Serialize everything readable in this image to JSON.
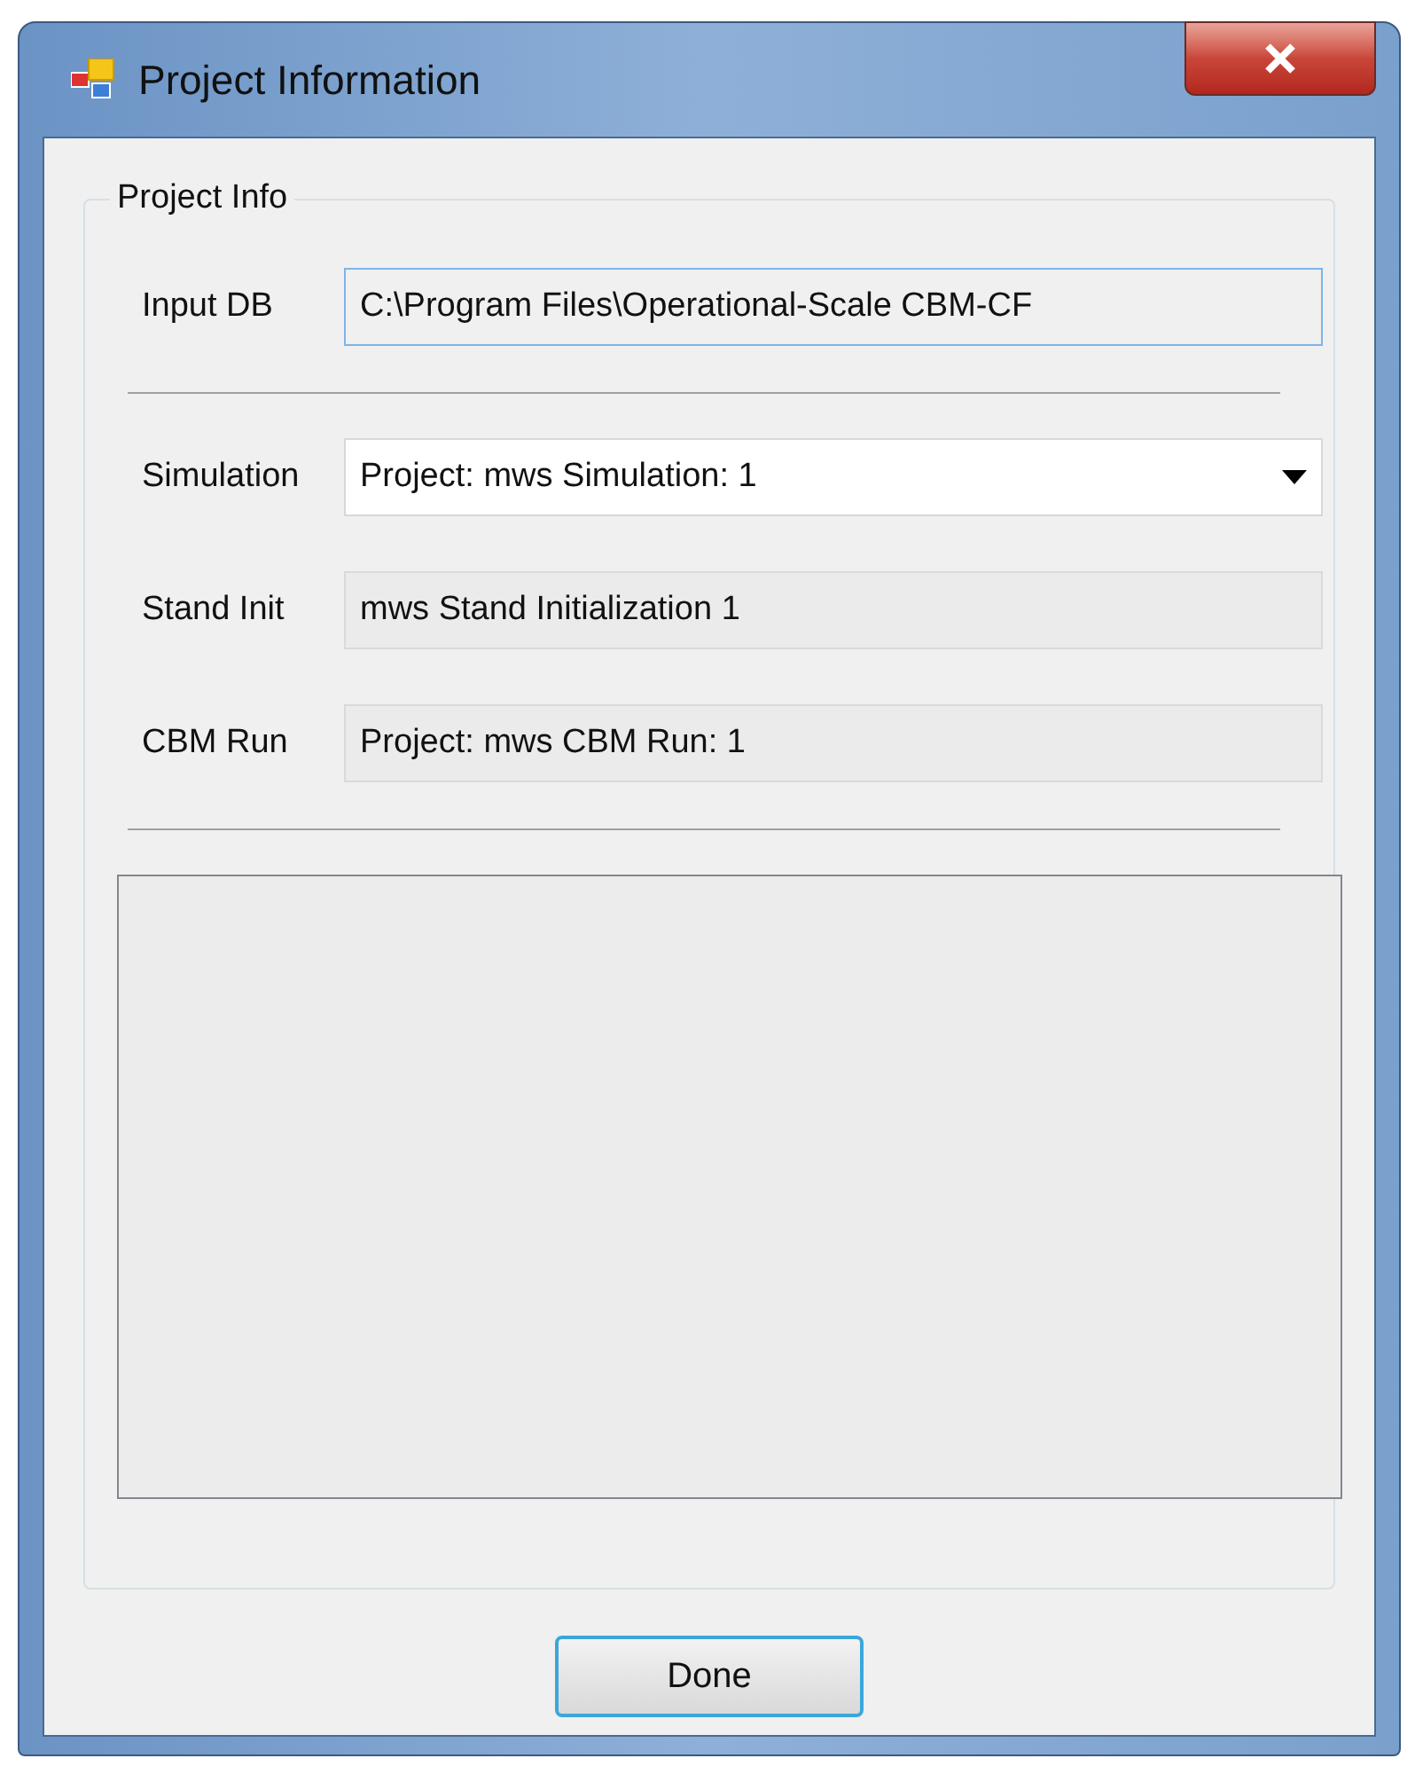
{
  "window": {
    "title": "Project Information"
  },
  "group": {
    "title": "Project Info",
    "sections": [
      [
        {
          "label": "Input DB",
          "kind": "path",
          "value": "C:\\Program Files\\Operational-Scale CBM-CF"
        }
      ],
      [
        {
          "label": "Simulation",
          "kind": "dropdown",
          "value": "Project: mws Simulation: 1"
        },
        {
          "label": "Stand Init",
          "kind": "readonly",
          "value": "mws Stand Initialization 1"
        },
        {
          "label": "CBM Run",
          "kind": "readonly",
          "value": "Project: mws CBM Run: 1"
        }
      ]
    ]
  },
  "buttons": [
    {
      "label": "Done",
      "default": true
    }
  ]
}
